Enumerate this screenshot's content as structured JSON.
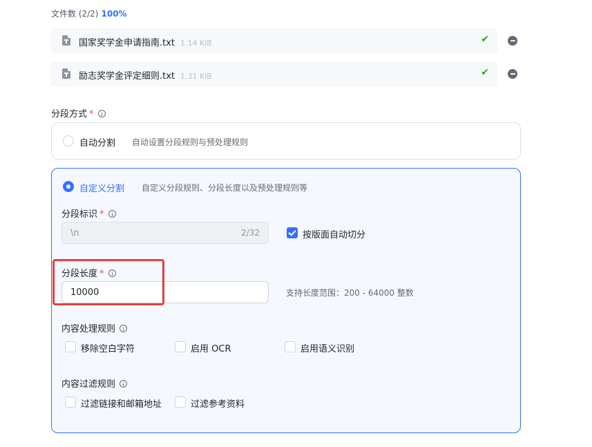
{
  "files": {
    "count_label": "文件数 (2/2)",
    "progress": "100%",
    "items": [
      {
        "name": "国家奖学金申请指南.txt",
        "size": "1.14 KiB"
      },
      {
        "name": "励志奖学金评定细则.txt",
        "size": "1.31 KiB"
      }
    ]
  },
  "segmentation": {
    "label": "分段方式",
    "required": "*",
    "options": [
      {
        "title": "自动分割",
        "desc": "自动设置分段规则与预处理规则",
        "selected": false
      },
      {
        "title": "自定义分割",
        "desc": "自定义分段规则、分段长度以及预处理规则等",
        "selected": true
      }
    ],
    "delimiter": {
      "label": "分段标识",
      "required": "*",
      "value": "\\n",
      "counter": "2/32",
      "auto_split_label": "按版面自动切分",
      "auto_split_checked": true
    },
    "length": {
      "label": "分段长度",
      "required": "*",
      "value": "10000",
      "hint": "支持长度范围：200 - 64000 整数"
    },
    "content_rules": {
      "label": "内容处理规则",
      "items": [
        {
          "label": "移除空白字符",
          "checked": false
        },
        {
          "label": "启用 OCR",
          "checked": false
        },
        {
          "label": "启用语义识别",
          "checked": false
        }
      ]
    },
    "filter_rules": {
      "label": "内容过滤规则",
      "items": [
        {
          "label": "过滤链接和邮箱地址",
          "checked": false
        },
        {
          "label": "过滤参考资料",
          "checked": false
        }
      ]
    }
  },
  "colors": {
    "accent": "#3370ff",
    "required": "#f54a45",
    "success": "#2ea121",
    "highlight_box": "#e0413f"
  }
}
